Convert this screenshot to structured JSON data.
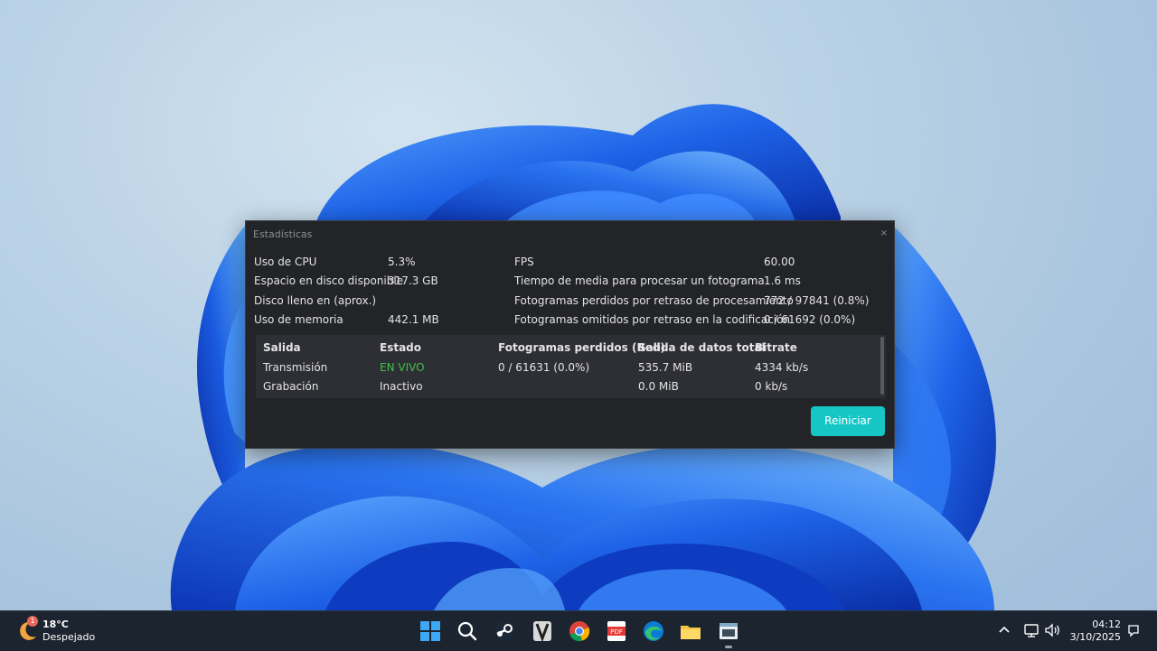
{
  "dialog": {
    "title": "Estadísticas",
    "close_label": "×",
    "left_stats": [
      {
        "label": "Uso de CPU",
        "value": "5.3%"
      },
      {
        "label": "Espacio en disco disponible",
        "value": "317.3 GB"
      },
      {
        "label": "Disco lleno en (aprox.)",
        "value": ""
      },
      {
        "label": "Uso de memoria",
        "value": "442.1 MB"
      }
    ],
    "right_stats": [
      {
        "label": "FPS",
        "value": "60.00"
      },
      {
        "label": "Tiempo de media para procesar un fotograma",
        "value": "1.6 ms"
      },
      {
        "label": "Fotogramas perdidos por retraso de procesamiento",
        "value": "772 / 97841 (0.8%)"
      },
      {
        "label": "Fotogramas omitidos por retraso en la codificación",
        "value": "0 / 61692 (0.0%)"
      }
    ],
    "outputs": {
      "headers": [
        "Salida",
        "Estado",
        "Fotogramas perdidos (Red)",
        "Salida de datos total",
        "Bitrate"
      ],
      "rows": [
        [
          "Transmisión",
          "EN VIVO",
          "0 / 61631 (0.0%)",
          "535.7 MiB",
          "4334 kb/s"
        ],
        [
          "Grabación",
          "Inactivo",
          "",
          "0.0 MiB",
          "0 kb/s"
        ]
      ],
      "live_color": "#3fbf4a"
    },
    "reset_label": "Reiniciar",
    "accent": "#16c6c6"
  },
  "taskbar": {
    "weather": {
      "temp": "18°C",
      "condition": "Despejado",
      "badge": "1"
    },
    "icons": [
      "windows-start-icon",
      "search-icon",
      "steam-icon",
      "game-app-icon",
      "chrome-icon",
      "pdf-app-icon",
      "edge-icon",
      "file-explorer-icon",
      "obs-stats-app-icon"
    ],
    "tray_icons": [
      "chevron-up-icon",
      "network-icon",
      "volume-icon"
    ],
    "time": "04:12",
    "date": "3/10/2025"
  }
}
